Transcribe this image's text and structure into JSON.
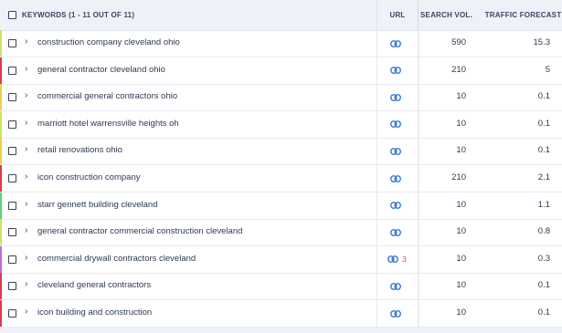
{
  "header": {
    "keywords_label": "KEYWORDS (1 - 11 OUT OF 11)",
    "url_label": "URL",
    "search_volume_label": "SEARCH VOL.",
    "traffic_forecast_label": "TRAFFIC FORECAST"
  },
  "colors": {
    "link_icon": "#3a78d6",
    "url_count": "#e24a3b"
  },
  "rows": [
    {
      "keyword": "construction company cleveland ohio",
      "url_count": "",
      "search_volume": "590",
      "traffic_forecast": "15.3",
      "indicator_color": "#c9e45b"
    },
    {
      "keyword": "general contractor cleveland ohio",
      "url_count": "",
      "search_volume": "210",
      "traffic_forecast": "5",
      "indicator_color": "#e2374f"
    },
    {
      "keyword": "commercial general contractors ohio",
      "url_count": "",
      "search_volume": "10",
      "traffic_forecast": "0.1",
      "indicator_color": "#f2cf4a"
    },
    {
      "keyword": "marriott hotel warrensville heights oh",
      "url_count": "",
      "search_volume": "10",
      "traffic_forecast": "0.1",
      "indicator_color": "#c9e45b"
    },
    {
      "keyword": "retail renovations ohio",
      "url_count": "",
      "search_volume": "10",
      "traffic_forecast": "0.1",
      "indicator_color": "#f2cf4a"
    },
    {
      "keyword": "icon construction company",
      "url_count": "",
      "search_volume": "210",
      "traffic_forecast": "2.1",
      "indicator_color": "#e2374f"
    },
    {
      "keyword": "starr gennett building cleveland",
      "url_count": "",
      "search_volume": "10",
      "traffic_forecast": "1.1",
      "indicator_color": "#5fd17a"
    },
    {
      "keyword": "general contractor commercial construction cleveland",
      "url_count": "",
      "search_volume": "10",
      "traffic_forecast": "0.8",
      "indicator_color": "#c9e45b"
    },
    {
      "keyword": "commercial drywall contractors cleveland",
      "url_count": "3",
      "search_volume": "10",
      "traffic_forecast": "0.3",
      "indicator_color": "#c06bd6"
    },
    {
      "keyword": "cleveland general contractors",
      "url_count": "",
      "search_volume": "10",
      "traffic_forecast": "0.1",
      "indicator_color": "#e2374f"
    },
    {
      "keyword": "icon building and construction",
      "url_count": "",
      "search_volume": "10",
      "traffic_forecast": "0.1",
      "indicator_color": "#e2374f"
    }
  ]
}
